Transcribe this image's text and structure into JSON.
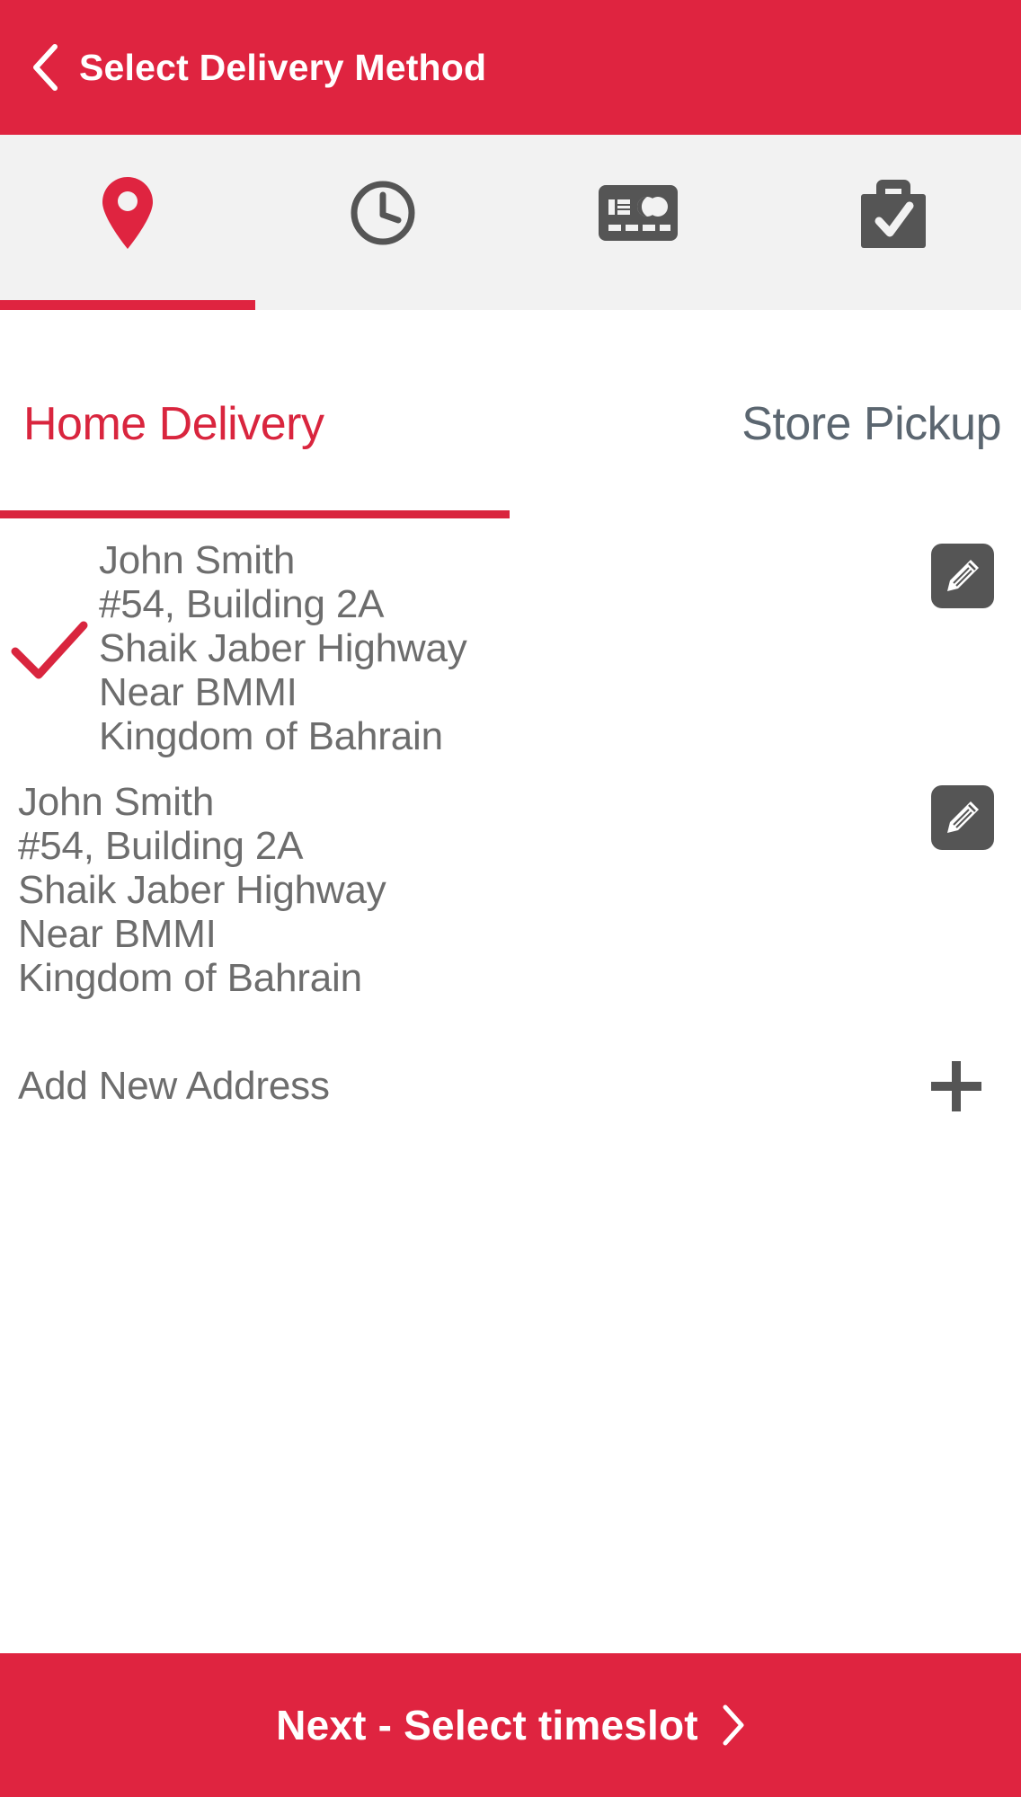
{
  "header": {
    "title": "Select Delivery Method",
    "back_icon": "chevron-left-icon",
    "background_color": "#df2440",
    "text_color": "#ffffff"
  },
  "steps": {
    "active_index": 0,
    "active_color": "#df2440",
    "inactive_color": "#555555",
    "background_color": "#f2f2f2",
    "items": [
      {
        "icon": "location-pin-icon",
        "name": "delivery-address",
        "active": true
      },
      {
        "icon": "clock-icon",
        "name": "timeslot",
        "active": false
      },
      {
        "icon": "credit-card-icon",
        "name": "payment",
        "active": false
      },
      {
        "icon": "briefcase-check-icon",
        "name": "confirm-order",
        "active": false
      }
    ]
  },
  "tabs": {
    "active_index": 0,
    "active_color": "#d9253e",
    "inactive_color": "#5b6670",
    "items": [
      {
        "label": "Home Delivery",
        "active": true
      },
      {
        "label": "Store Pickup",
        "active": false
      }
    ]
  },
  "addresses": [
    {
      "selected": true,
      "check_icon": "check-icon",
      "check_color": "#d9253e",
      "edit_icon": "pencil-icon",
      "lines": [
        "John Smith",
        "#54, Building 2A",
        "Shaik Jaber Highway",
        "Near BMMI",
        "Kingdom of Bahrain"
      ]
    },
    {
      "selected": false,
      "edit_icon": "pencil-icon",
      "lines": [
        "John Smith",
        "#54, Building 2A",
        "Shaik Jaber Highway",
        "Near BMMI",
        "Kingdom of Bahrain"
      ]
    }
  ],
  "add_address": {
    "label": "Add New Address",
    "icon": "plus-icon"
  },
  "cta": {
    "label": "Next - Select timeslot",
    "icon": "chevron-right-icon",
    "background_color": "#df2440",
    "text_color": "#ffffff"
  }
}
